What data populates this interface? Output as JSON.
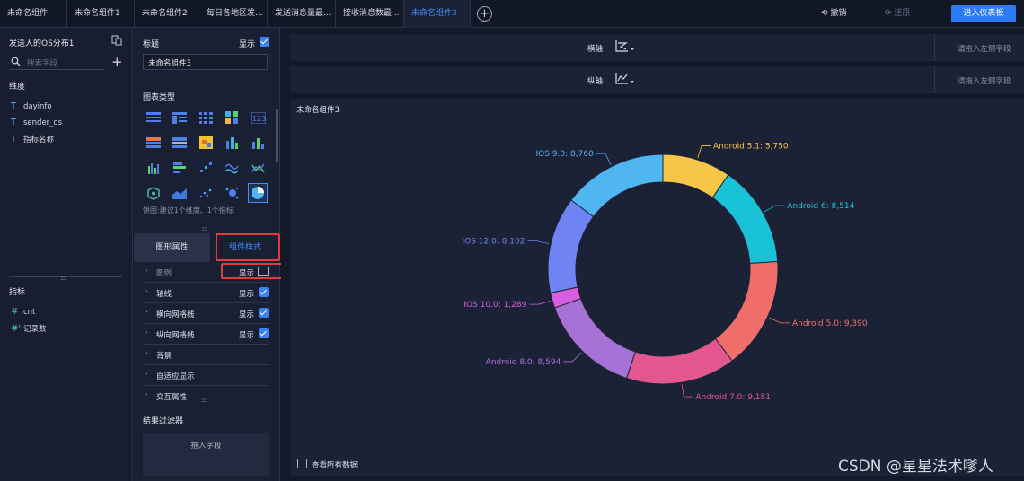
{
  "tabs": [
    {
      "label": "未命名组件",
      "active": false
    },
    {
      "label": "未命名组件1",
      "active": false
    },
    {
      "label": "未命名组件2",
      "active": false
    },
    {
      "label": "每日各地区发...",
      "active": false
    },
    {
      "label": "发送消息量最...",
      "active": false
    },
    {
      "label": "接收消息数最...",
      "active": false
    },
    {
      "label": "未命名组件3",
      "active": true
    }
  ],
  "toolbar": {
    "undo": "撤销",
    "redo": "还原",
    "enter": "进入仪表板"
  },
  "left": {
    "dataset": "发送人的OS分布1",
    "search_placeholder": "搜索字段",
    "dimension_title": "维度",
    "dimensions": [
      {
        "icon": "T",
        "name": "dayinfo"
      },
      {
        "icon": "T",
        "name": "sender_os"
      },
      {
        "icon": "T",
        "name": "指标名称"
      }
    ],
    "measure_title": "指标",
    "measures": [
      {
        "icon": "#",
        "name": "cnt"
      },
      {
        "icon": "#'",
        "name": "记录数"
      }
    ]
  },
  "mid": {
    "title_label": "标题",
    "title_show": "显示",
    "title_value": "未命名组件3",
    "chart_type_label": "图表类型",
    "chart_hint": "饼图:建议1个维度、1个指标",
    "tab_graph": "图形属性",
    "tab_style": "组件样式",
    "props": [
      {
        "label": "图例",
        "show": "显示",
        "checked": false
      },
      {
        "label": "轴线",
        "show": "显示",
        "checked": true
      },
      {
        "label": "横向网格线",
        "show": "显示",
        "checked": true
      },
      {
        "label": "纵向网格线",
        "show": "显示",
        "checked": true
      },
      {
        "label": "背景",
        "show": "",
        "checked": false
      },
      {
        "label": "自适应显示",
        "show": "",
        "checked": false
      },
      {
        "label": "交互属性",
        "show": "",
        "checked": false
      }
    ],
    "filter_title": "结果过滤器",
    "filter_drop": "拖入字段"
  },
  "main": {
    "x_axis_label": "横轴",
    "y_axis_label": "纵轴",
    "drop_hint": "请拖入左侧字段",
    "chart_title": "未命名组件3",
    "view_all": "查看所有数据",
    "watermark": "CSDN @星星法术嗲人"
  },
  "chart_data": {
    "type": "pie",
    "donut": true,
    "slices": [
      {
        "label": "Android 5.1",
        "value": 5750,
        "text": "Android 5.1:  5,750",
        "color": "#f7c548"
      },
      {
        "label": "Android 6",
        "value": 8514,
        "text": "Android 6:  8,514",
        "color": "#19c2d6"
      },
      {
        "label": "Android 5.0",
        "value": 9390,
        "text": "Android 5.0:  9,390",
        "color": "#f06e6a"
      },
      {
        "label": "Android 7.0",
        "value": 9181,
        "text": "Android 7.0:  9,181",
        "color": "#e2578e"
      },
      {
        "label": "Android 8.0",
        "value": 8594,
        "text": "Android 8.0:  8,594",
        "color": "#a772d6"
      },
      {
        "label": "IOS 10.0",
        "value": 1289,
        "text": "IOS 10.0:  1,289",
        "color": "#d85de0"
      },
      {
        "label": "IOS 12.0",
        "value": 8102,
        "text": "IOS 12.0:  8,102",
        "color": "#6f84f2"
      },
      {
        "label": "IOS 9.0",
        "value": 8760,
        "text": "IOS 9.0:  8,760",
        "color": "#4fb6f2"
      }
    ]
  }
}
